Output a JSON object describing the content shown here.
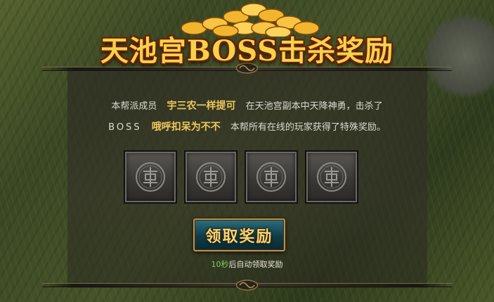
{
  "title": "天池宫BOSS击杀奖励",
  "message": {
    "line1_prefix": "本帮派成员",
    "member_name": "宇三农一样提可",
    "line1_suffix": "在天池宫副本中天降神勇，击杀了",
    "boss_label": "BOSS",
    "boss_name": "哦呼扣呆为不不",
    "line2_suffix": "本帮所有在线的玩家获得了特殊奖励。"
  },
  "reward_slots": [
    {
      "icon": "locked-emblem-icon"
    },
    {
      "icon": "locked-emblem-icon"
    },
    {
      "icon": "locked-emblem-icon"
    },
    {
      "icon": "locked-emblem-icon"
    }
  ],
  "claim_button_label": "领取奖励",
  "countdown": {
    "seconds_label": "10秒",
    "text": "后自动领取奖励"
  },
  "colors": {
    "title_gold": "#f6d24a",
    "highlight_gold": "#f0c85a",
    "countdown_green": "#7fd25a",
    "button_teal": "#0f3b48"
  }
}
